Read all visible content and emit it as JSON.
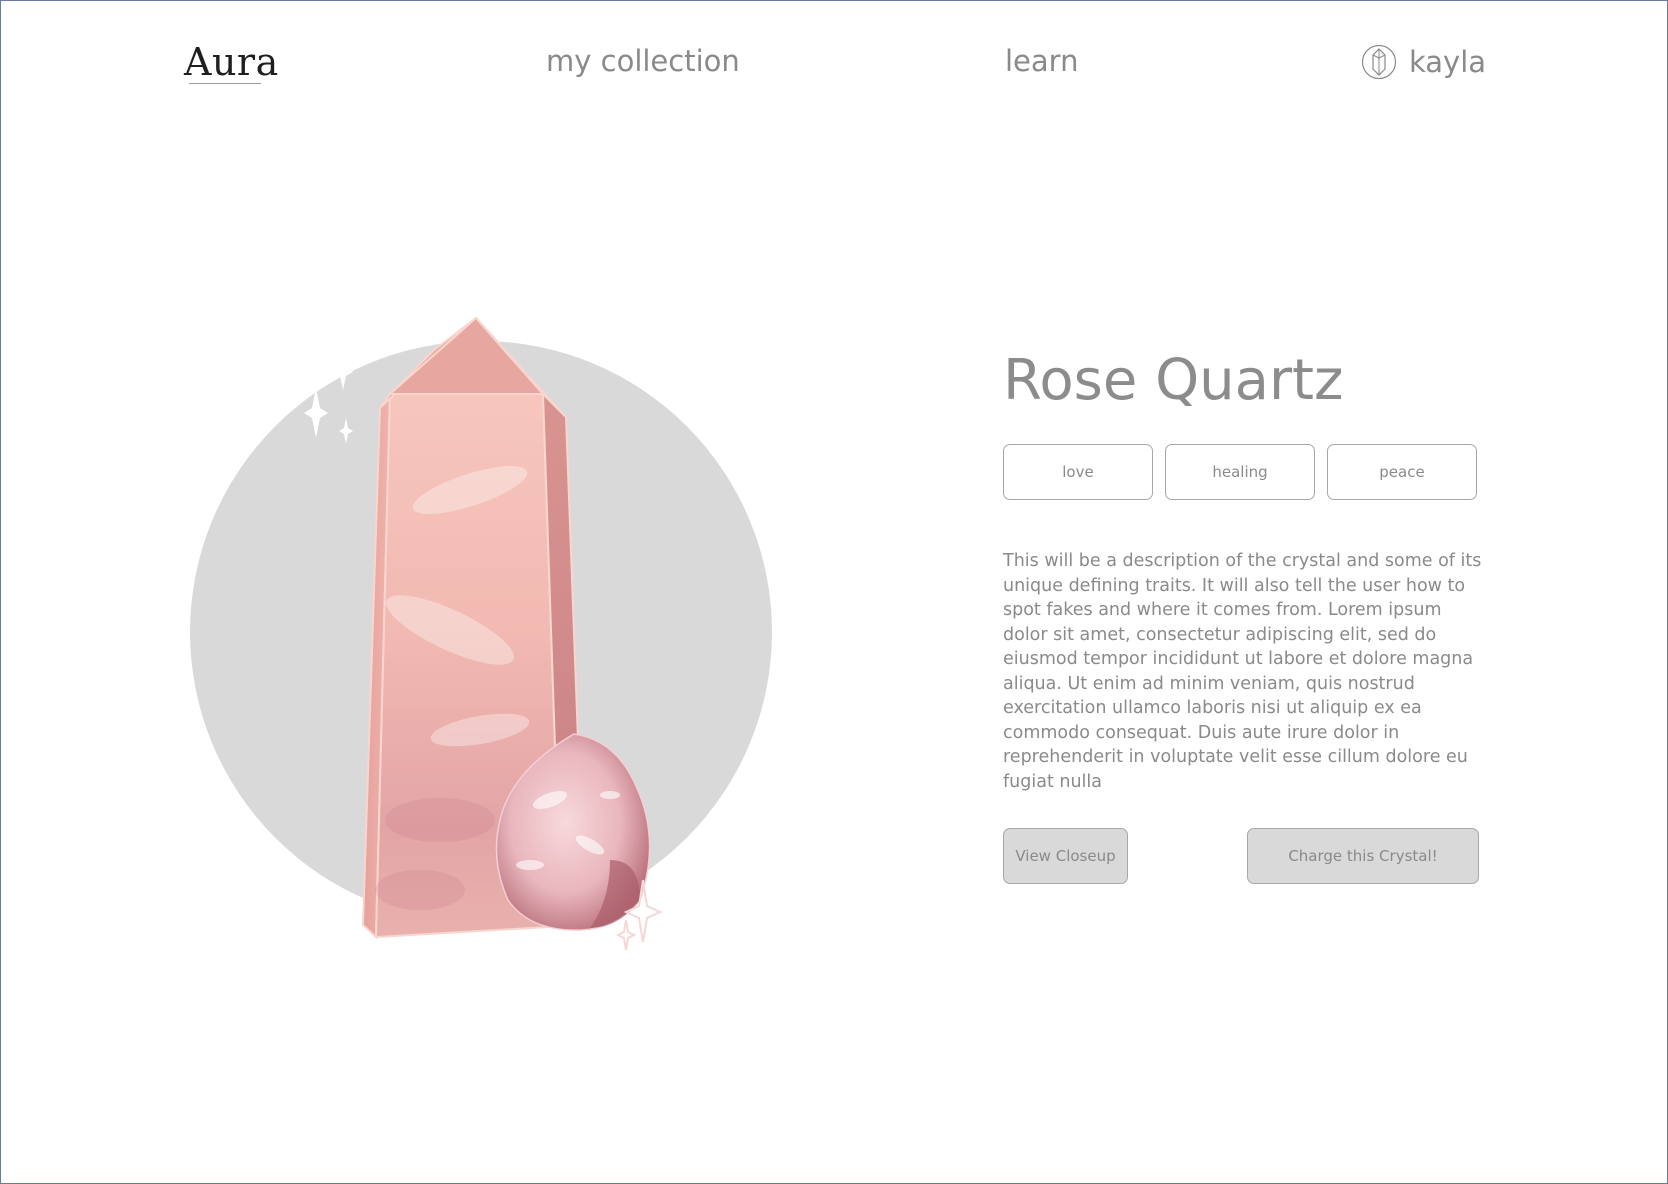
{
  "app": {
    "logo": "Aura"
  },
  "nav": {
    "my_collection": "my collection",
    "learn": "learn",
    "user_name": "kayla",
    "user_icon": "crystal-avatar-icon"
  },
  "crystal": {
    "name": "Rose Quartz",
    "tags": [
      {
        "label": "love"
      },
      {
        "label": "healing"
      },
      {
        "label": "peace"
      }
    ],
    "description": "This will be a description of the crystal and some of its unique defining traits. It will also tell the user how to spot fakes and where it comes from. Lorem ipsum dolor sit amet, consectetur adipiscing elit, sed do eiusmod tempor incididunt ut labore et dolore magna aliqua. Ut enim ad minim veniam, quis nostrud exercitation ullamco laboris nisi ut aliquip ex ea commodo consequat. Duis aute irure dolor in reprehenderit in voluptate velit esse cillum dolore eu fugiat nulla",
    "illustration_icon": "rose-quartz-illustration"
  },
  "actions": {
    "view_closeup": "View Closeup",
    "charge": "Charge this Crystal!"
  },
  "colors": {
    "text_gray": "#8a8a8a",
    "circle_gray": "#d9d9d9",
    "crystal_pink": "#f0b6b0",
    "crystal_dark_pink": "#d98e8a",
    "button_fill": "#d9d9d9",
    "border_gray": "#a8a8a8"
  }
}
